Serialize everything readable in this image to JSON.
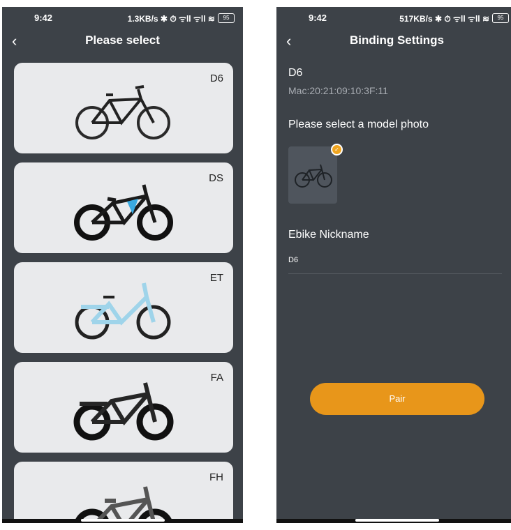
{
  "left": {
    "status": {
      "time": "9:42",
      "network": "1.3KB/s ✱ ⏱ ᯤll ᯤll ≋",
      "battery": "95"
    },
    "title": "Please select",
    "cards": [
      {
        "label": "D6"
      },
      {
        "label": "DS"
      },
      {
        "label": "ET"
      },
      {
        "label": "FA"
      },
      {
        "label": "FH"
      }
    ]
  },
  "right": {
    "status": {
      "time": "9:42",
      "network": "517KB/s ✱ ⏱ ᯤll ᯤll ≋",
      "battery": "95"
    },
    "title": "Binding Settings",
    "device_name": "D6",
    "mac": "Mac:20:21:09:10:3F:11",
    "model_photo_label": "Please select a model photo",
    "nickname_label": "Ebike Nickname",
    "nickname_value": "D6",
    "pair_label": "Pair"
  },
  "colors": {
    "background": "#3d4248",
    "card": "#e9eaec",
    "accent": "#e8961a"
  }
}
